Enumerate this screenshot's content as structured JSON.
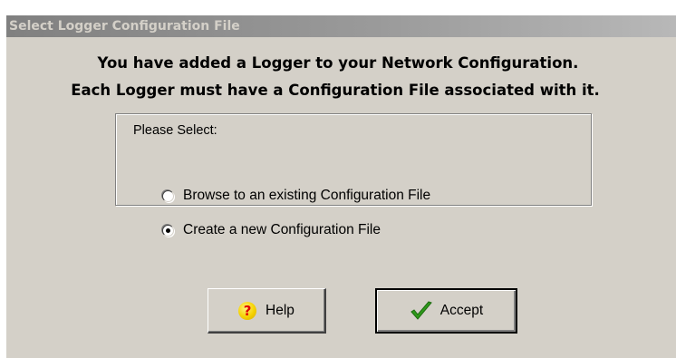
{
  "dialog": {
    "title": "Select Logger Configuration File",
    "message_line1": "You have added a Logger to your Network Configuration.",
    "message_line2": "Each Logger must have a Configuration File associated with it."
  },
  "options": {
    "group_label": "Please Select:",
    "items": [
      {
        "label": "Browse to an existing Configuration File",
        "checked": false
      },
      {
        "label": "Create a new Configuration File",
        "checked": true
      }
    ]
  },
  "buttons": {
    "help": {
      "label": "Help",
      "icon": "help-question-icon"
    },
    "accept": {
      "label": "Accept",
      "icon": "checkmark-icon"
    }
  },
  "colors": {
    "dialog_bg": "#d4d0c8",
    "titlebar_start": "#808080",
    "titlebar_end": "#b8b8b8",
    "checkmark_green": "#2e9a1a",
    "help_icon_yellow": "#f5d200",
    "help_icon_mark": "#e00000"
  }
}
